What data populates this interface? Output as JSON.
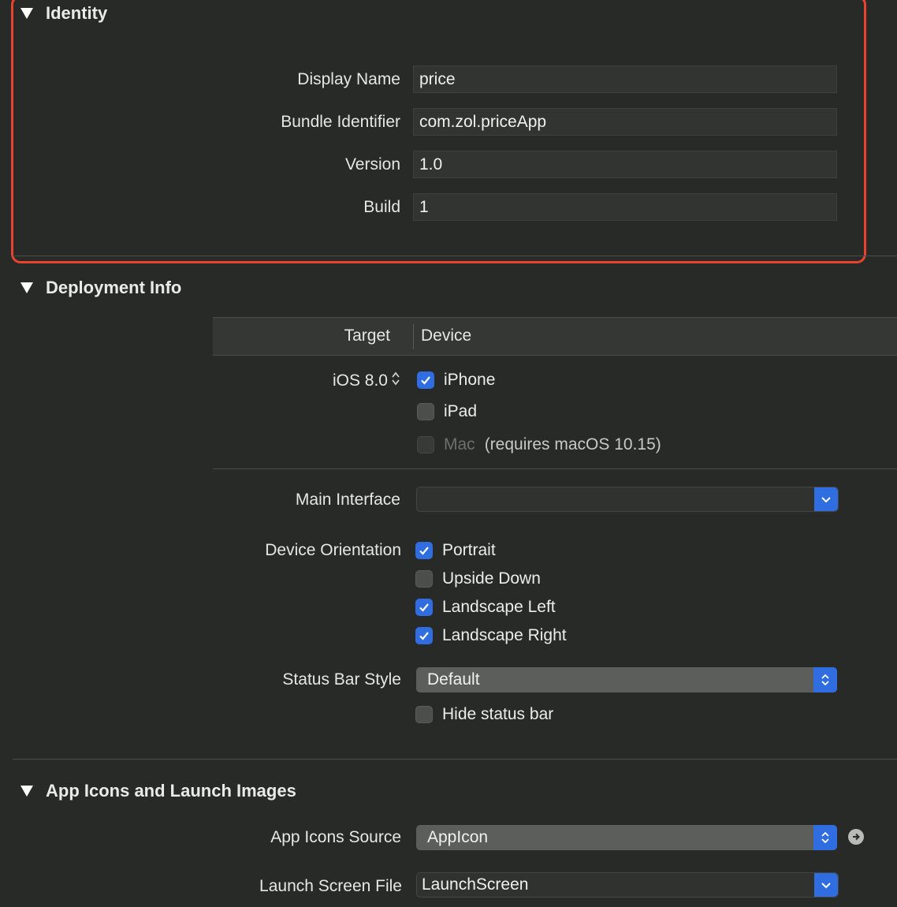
{
  "identity": {
    "title": "Identity",
    "fields": [
      {
        "label": "Display Name",
        "value": "price"
      },
      {
        "label": "Bundle Identifier",
        "value": "com.zol.priceApp"
      },
      {
        "label": "Version",
        "value": "1.0"
      },
      {
        "label": "Build",
        "value": "1"
      }
    ]
  },
  "deployment": {
    "title": "Deployment Info",
    "table": {
      "target_header": "Target",
      "device_header": "Device"
    },
    "ios_version": "iOS 8.0",
    "devices": [
      {
        "label": "iPhone",
        "checked": true
      },
      {
        "label": "iPad",
        "checked": false
      },
      {
        "label": "Mac",
        "checked": false,
        "disabled": true,
        "note": "(requires macOS 10.15)"
      }
    ],
    "main_interface": {
      "label": "Main Interface",
      "value": ""
    },
    "device_orientation": {
      "label": "Device Orientation",
      "options": [
        {
          "label": "Portrait",
          "checked": true
        },
        {
          "label": "Upside Down",
          "checked": false
        },
        {
          "label": "Landscape Left",
          "checked": true
        },
        {
          "label": "Landscape Right",
          "checked": true
        }
      ]
    },
    "status_bar_style": {
      "label": "Status Bar Style",
      "value": "Default"
    },
    "hide_status_bar": {
      "label": "Hide status bar",
      "checked": false
    }
  },
  "app_icons": {
    "title": "App Icons and Launch Images",
    "icons_source": {
      "label": "App Icons Source",
      "value": "AppIcon"
    },
    "launch_screen": {
      "label": "Launch Screen File",
      "value": "LaunchScreen"
    }
  },
  "colors": {
    "accent": "#2f6de1",
    "highlight": "#e8432e",
    "background": "#282a28"
  }
}
